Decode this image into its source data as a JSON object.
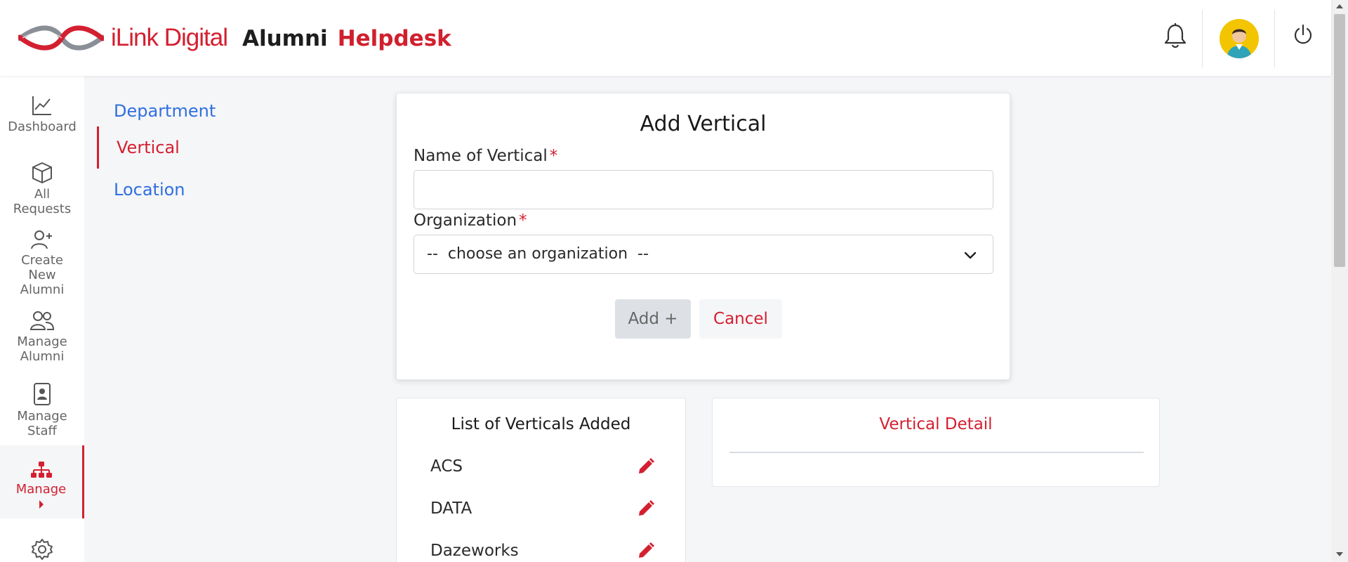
{
  "header": {
    "brand": "iLink Digital",
    "title_part1": "Alumni",
    "title_part2": "Helpdesk",
    "icons": [
      "bell-icon",
      "user-avatar",
      "power-icon"
    ]
  },
  "sidebar": {
    "items": [
      {
        "label": "Dashboard",
        "icon": "chart-line-icon"
      },
      {
        "label": "All Requests",
        "icon": "box-icon"
      },
      {
        "label": "Create New Alumni",
        "icon": "user-plus-icon"
      },
      {
        "label": "Manage Alumni",
        "icon": "users-icon"
      },
      {
        "label": "Manage Staff",
        "icon": "id-badge-icon"
      },
      {
        "label": "Manage",
        "icon": "org-chart-icon",
        "active": true
      },
      {
        "label": "",
        "icon": "gear-icon"
      }
    ]
  },
  "subnav": {
    "items": [
      {
        "label": "Department"
      },
      {
        "label": "Vertical",
        "active": true
      },
      {
        "label": "Location"
      }
    ]
  },
  "form": {
    "title": "Add Vertical",
    "name_label": "Name of Vertical",
    "name_value": "",
    "required_mark": "*",
    "org_label": "Organization",
    "org_selected": "--  choose an organization  --",
    "add_label": "Add +",
    "cancel_label": "Cancel"
  },
  "list": {
    "title": "List of Verticals Added",
    "items": [
      "ACS",
      "DATA",
      "Dazeworks"
    ]
  },
  "detail": {
    "title": "Vertical Detail"
  },
  "colors": {
    "accent": "#d32030",
    "link": "#2f6fdf",
    "avatar_bg": "#f3c400"
  }
}
